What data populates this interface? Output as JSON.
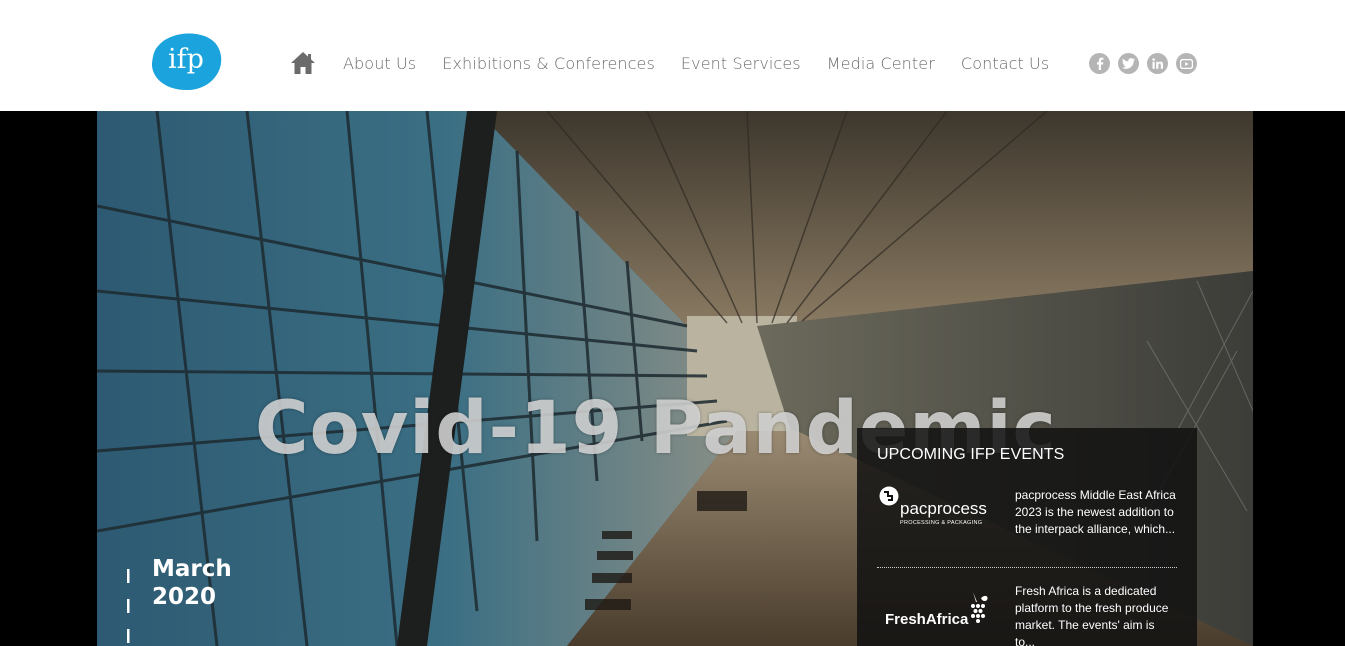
{
  "brand": {
    "logo_text": "ifp",
    "logo_color": "#1aa3dc"
  },
  "nav": {
    "home_icon": "home-icon",
    "items": [
      {
        "label": "About Us"
      },
      {
        "label": "Exhibitions & Conferences"
      },
      {
        "label": "Event Services"
      },
      {
        "label": "Media Center"
      },
      {
        "label": "Contact Us"
      }
    ]
  },
  "social": {
    "icons": [
      "facebook-icon",
      "twitter-icon",
      "linkedin-icon",
      "youtube-icon"
    ],
    "color": "#b5b5b5"
  },
  "hero": {
    "title": "Covid-19 Pandemic",
    "date_line1": "March",
    "date_line2": "2020"
  },
  "events": {
    "heading": "UPCOMING IFP EVENTS",
    "items": [
      {
        "logo_name": "pacprocess",
        "logo_sub": "PROCESSING & PACKAGING",
        "description": "pacprocess Middle East Africa 2023 is the newest addition to the interpack alliance, which..."
      },
      {
        "logo_name": "FreshAfrica",
        "description": "Fresh Africa is a dedicated platform to the fresh produce market. The events' aim is to..."
      }
    ]
  }
}
